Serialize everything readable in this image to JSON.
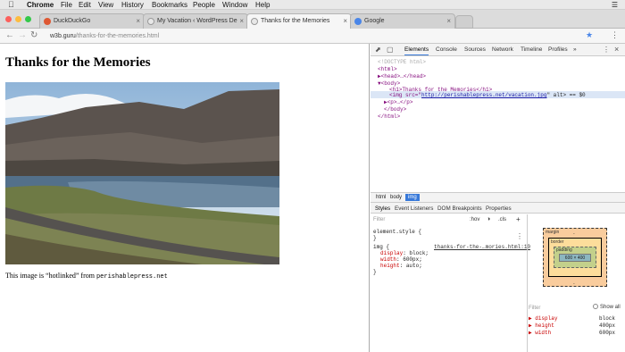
{
  "menubar": {
    "items": [
      "Chrome",
      "File",
      "Edit",
      "View",
      "History",
      "Bookmarks",
      "People",
      "Window",
      "Help"
    ]
  },
  "tabs": [
    {
      "label": "DuckDuckGo",
      "favicon_color": "#de5833"
    },
    {
      "label": "My Vacation ‹ WordPress De",
      "favicon_color": "#e8e8e8"
    },
    {
      "label": "Thanks for the Memories",
      "favicon_color": "#e8e8e8"
    },
    {
      "label": "Google",
      "favicon_color": "#4a86e8"
    }
  ],
  "omnibox": {
    "host": "w3b.guru",
    "path": "/thanks-for-the-memories.html"
  },
  "page": {
    "heading": "Thanks for the Memories",
    "caption_before": "This image is “hotlinked” from ",
    "caption_code": "perishablepress.net"
  },
  "devtools": {
    "tabs": [
      "Elements",
      "Console",
      "Sources",
      "Network",
      "Timeline",
      "Profiles",
      "»"
    ],
    "dom": {
      "doctype": "<!DOCTYPE html>",
      "html_open": "<html>",
      "head": "▶<head>…</head>",
      "body_open": "▼<body>",
      "h1": "<h1>Thanks for the Memories</h1>",
      "img_tag": "<img src=\"",
      "img_src": "http://perishablepress.net/vacation.jpg",
      "img_rest": "\" alt> == $0",
      "p": "▶<p>…</p>",
      "body_close": "</body>",
      "html_close": "</html>"
    },
    "breadcrumbs": [
      "html",
      "body",
      "img"
    ],
    "subtabs": [
      "Styles",
      "Event Listeners",
      "DOM Breakpoints",
      "Properties"
    ],
    "filter_placeholder": "Filter",
    "filter_tools": [
      ":hov",
      ".cls",
      "+"
    ],
    "styles": {
      "element_style": "element.style {",
      "close1": "}",
      "img_selector": "img {",
      "source": "thanks-for-the-…mories.html:10",
      "rules": [
        {
          "prop": "display",
          "value": "block;"
        },
        {
          "prop": "width",
          "value": "600px;"
        },
        {
          "prop": "height",
          "value": "auto;"
        }
      ],
      "close2": "}"
    },
    "boxmodel": {
      "margin": "margin",
      "border": "border",
      "padding": "padding",
      "content": "600 × 400",
      "dash": "-"
    },
    "computed": {
      "filter": "Filter",
      "show_all": "Show all",
      "rows": [
        {
          "prop": "display",
          "value": "block"
        },
        {
          "prop": "height",
          "value": "400px"
        },
        {
          "prop": "width",
          "value": "600px"
        }
      ]
    }
  }
}
